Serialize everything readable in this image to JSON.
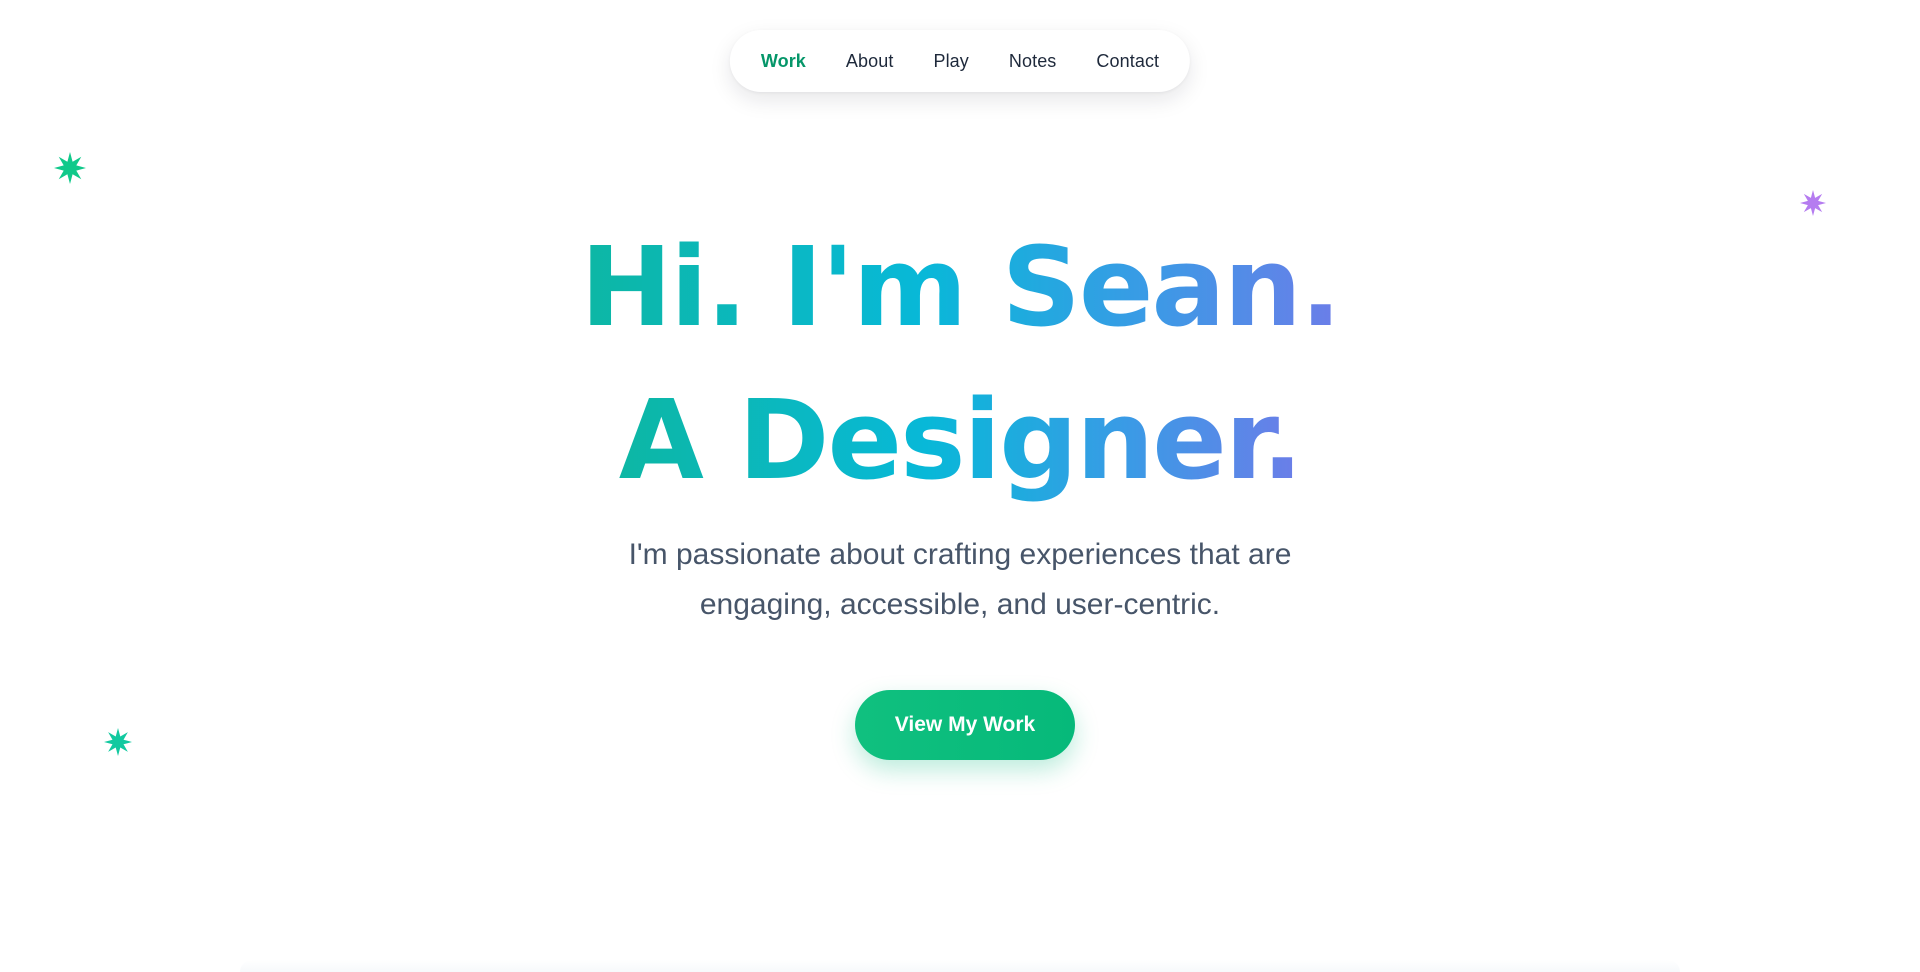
{
  "nav": {
    "items": [
      {
        "label": "Work",
        "active": true
      },
      {
        "label": "About",
        "active": false
      },
      {
        "label": "Play",
        "active": false
      },
      {
        "label": "Notes",
        "active": false
      },
      {
        "label": "Contact",
        "active": false
      }
    ]
  },
  "hero": {
    "headline_line1": "Hi. I'm Sean.",
    "headline_line2": "A Designer.",
    "subtitle_line1": "I'm passionate about crafting experiences that are",
    "subtitle_line2": "engaging, accessible, and user-centric.",
    "cta_label": "View My Work"
  },
  "decorations": {
    "sparkles": [
      {
        "icon": "sparkle-icon",
        "color": "#10c98a"
      },
      {
        "icon": "sparkle-icon",
        "color": "#b57cf0"
      },
      {
        "icon": "sparkle-icon",
        "color": "#12c9a0"
      }
    ]
  },
  "colors": {
    "accent_green": "#059669",
    "cta_green": "#10c07f",
    "headline_gradient": [
      "#0db7a4",
      "#08b8d8",
      "#3b9ae6",
      "#6c7de8"
    ],
    "body_text": "#475569",
    "nav_text": "#1e293b"
  }
}
